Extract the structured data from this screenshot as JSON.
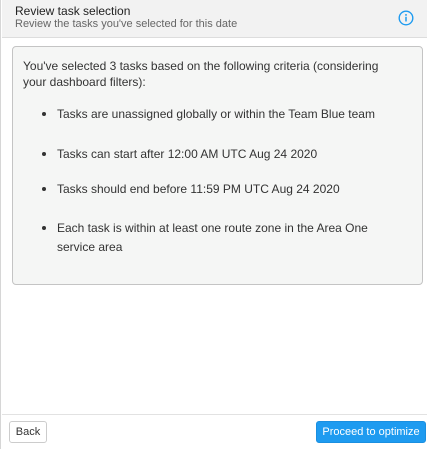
{
  "header": {
    "title": "Review task selection",
    "subtitle": "Review the tasks you've selected for this date",
    "info_icon": "info-circle-icon",
    "info_color": "#1e9bf0"
  },
  "summary": {
    "intro": "You've selected 3 tasks based on the following criteria (considering your dashboard filters):",
    "criteria": [
      "Tasks are unassigned globally or within the Team Blue team",
      "Tasks can start after 12:00 AM UTC Aug 24 2020",
      "Tasks should end before 11:59 PM UTC Aug 24 2020",
      "Each task is within at least one route zone in the Area One service area"
    ]
  },
  "footer": {
    "back_label": "Back",
    "proceed_label": "Proceed to optimize",
    "primary_color": "#1e9bf0"
  }
}
